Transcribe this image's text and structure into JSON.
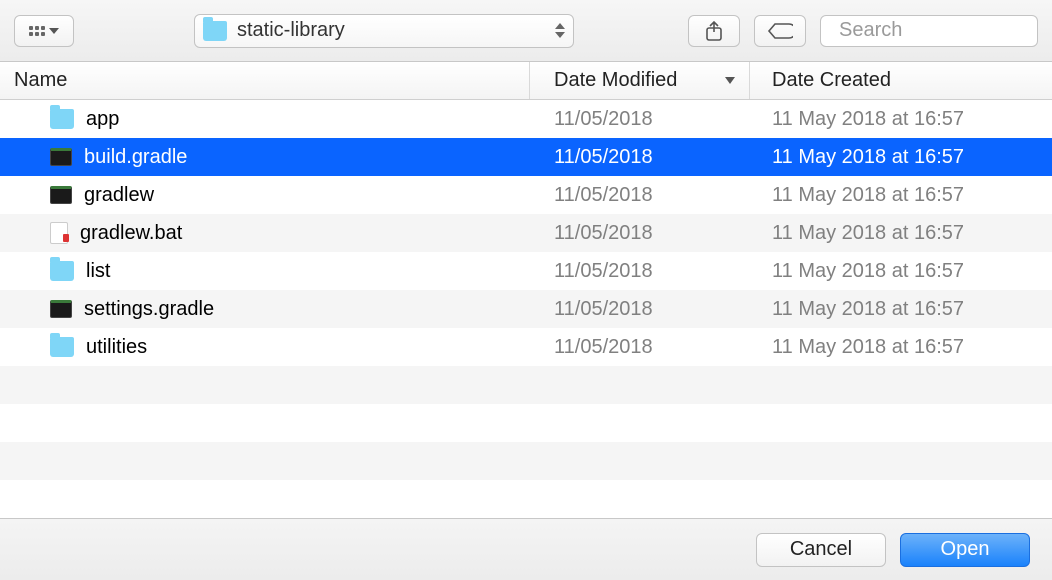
{
  "toolbar": {
    "path_label": "static-library",
    "search_placeholder": "Search"
  },
  "columns": {
    "name": "Name",
    "modified": "Date Modified",
    "created": "Date Created"
  },
  "files": [
    {
      "name": "app",
      "type": "folder",
      "modified": "11/05/2018",
      "created": "11 May 2018 at 16:57",
      "selected": false
    },
    {
      "name": "build.gradle",
      "type": "terminal",
      "modified": "11/05/2018",
      "created": "11 May 2018 at 16:57",
      "selected": true
    },
    {
      "name": "gradlew",
      "type": "terminal",
      "modified": "11/05/2018",
      "created": "11 May 2018 at 16:57",
      "selected": false
    },
    {
      "name": "gradlew.bat",
      "type": "script",
      "modified": "11/05/2018",
      "created": "11 May 2018 at 16:57",
      "selected": false
    },
    {
      "name": "list",
      "type": "folder",
      "modified": "11/05/2018",
      "created": "11 May 2018 at 16:57",
      "selected": false
    },
    {
      "name": "settings.gradle",
      "type": "terminal",
      "modified": "11/05/2018",
      "created": "11 May 2018 at 16:57",
      "selected": false
    },
    {
      "name": "utilities",
      "type": "folder",
      "modified": "11/05/2018",
      "created": "11 May 2018 at 16:57",
      "selected": false
    }
  ],
  "footer": {
    "cancel": "Cancel",
    "open": "Open"
  }
}
